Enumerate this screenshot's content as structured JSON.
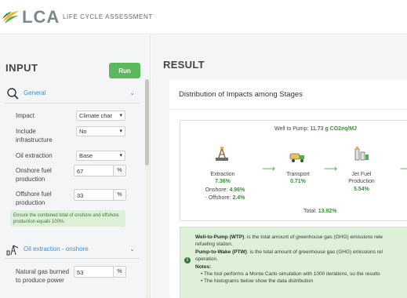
{
  "header": {
    "logo_text": "LCA",
    "logo_sub": "LIFE CYCLE ASSESSMENT"
  },
  "input": {
    "title": "INPUT",
    "run_label": "Run",
    "general": {
      "label": "General",
      "impact_label": "Impact",
      "impact_value": "Climate char",
      "infra_label": "Include infrastructure",
      "infra_value": "No",
      "oil_label": "Oil extraction",
      "oil_value": "Base",
      "onshore_label": "Onshore fuel production",
      "onshore_value": "67",
      "offshore_label": "Offshore fuel production",
      "offshore_value": "33",
      "percent": "%",
      "note": "Ensure the combined total of onshore and offshore production equals 100%."
    },
    "oil_onshore": {
      "label": "Oil extraction - onshore",
      "gas_label": "Natural gas burned to produce power",
      "gas_value": "53",
      "percent": "%"
    }
  },
  "result": {
    "title": "RESULT",
    "card_title": "Distribution of Impacts among Stages",
    "wtp_prefix": "Well to Pump: ",
    "wtp_value": "11.73 g CO2eq/MJ",
    "stages": [
      {
        "name": "Extraction",
        "value": "7.36%",
        "onshore_prefix": "Onshore: ",
        "onshore_value": "4.96%",
        "offshore_prefix": "- Offshore: ",
        "offshore_value": "2.4%"
      },
      {
        "name": "Transport",
        "value": "0.71%"
      },
      {
        "name": "Jet Fuel Production",
        "value": "5.54%"
      }
    ],
    "total_prefix": "Total: ",
    "total_value": "13.92%",
    "info": {
      "wtp_term": "Well-to-Pump (WTP)",
      "wtp_text": ": is the total amount of greenhouse gas (GHG) emissions rele",
      "wtp_text2": "refueling station.",
      "ptw_term": "Pump-to-Wake (PTW)",
      "ptw_text": ": is the total amount of greenhouse gas (GHG) emissions rel",
      "ptw_text2": "operation.",
      "notes_label": "Notes:",
      "note1": "The tool performs a Monte Carlo simulation with 1000 iterations, so the results",
      "note2": "The histograms below show the data distribution"
    }
  },
  "colors": {
    "accent_green": "#5cb85c",
    "link_blue": "#3b8ed8",
    "value_green": "#3c8d3c",
    "info_bg": "#dff0d8"
  }
}
